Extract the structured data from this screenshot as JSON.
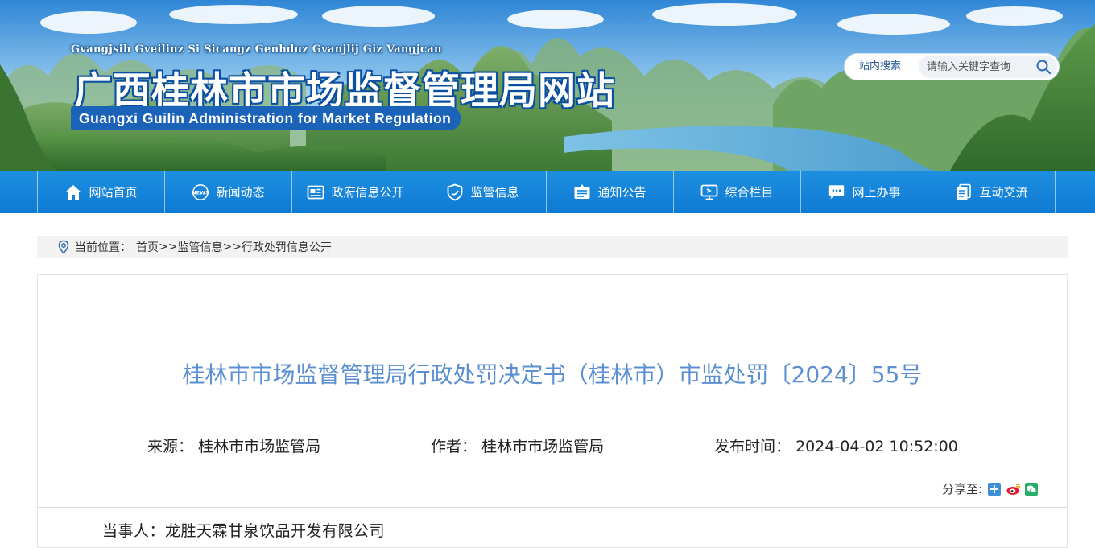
{
  "header": {
    "pinyin_title": "Gvangjsih Gveilinz Si Sicangz Genhduz Gvanjlij Giz Vangjcan",
    "title": "广西桂林市市场监督管理局网站",
    "title_en": "Guangxi Guilin Administration for Market Regulation",
    "search": {
      "label": "站内搜索",
      "placeholder": "请输入关键字查询",
      "icon": "search-icon"
    }
  },
  "nav": {
    "items": [
      {
        "label": "网站首页",
        "icon": "home-icon"
      },
      {
        "label": "新闻动态",
        "icon": "news-icon"
      },
      {
        "label": "政府信息公开",
        "icon": "newspaper-icon"
      },
      {
        "label": "监管信息",
        "icon": "shield-icon"
      },
      {
        "label": "通知公告",
        "icon": "notice-board-icon"
      },
      {
        "label": "综合栏目",
        "icon": "monitor-icon"
      },
      {
        "label": "网上办事",
        "icon": "chat-icon"
      },
      {
        "label": "互动交流",
        "icon": "documents-icon"
      }
    ]
  },
  "breadcrumb": {
    "prefix": "当前位置：",
    "items": [
      "首页",
      "监管信息",
      "行政处罚信息公开"
    ],
    "separator": ">>"
  },
  "article": {
    "title": "桂林市市场监督管理局行政处罚决定书（桂林市）市监处罚〔2024〕55号",
    "source_label": "来源：",
    "source": "桂林市市场监管局",
    "author_label": "作者：",
    "author": "桂林市市场监管局",
    "date_label": "发布时间：",
    "date": "2024-04-02 10:52:00",
    "share_label": "分享至:",
    "share_icons": [
      "share-plus-icon",
      "weibo-icon",
      "wechat-icon"
    ],
    "party": "当事人：龙胜天霖甘泉饮品开发有限公司"
  },
  "colors": {
    "nav_bg": "#1384d9",
    "title_blue": "#5b8fd1",
    "brand_blue": "#1a63b8"
  }
}
